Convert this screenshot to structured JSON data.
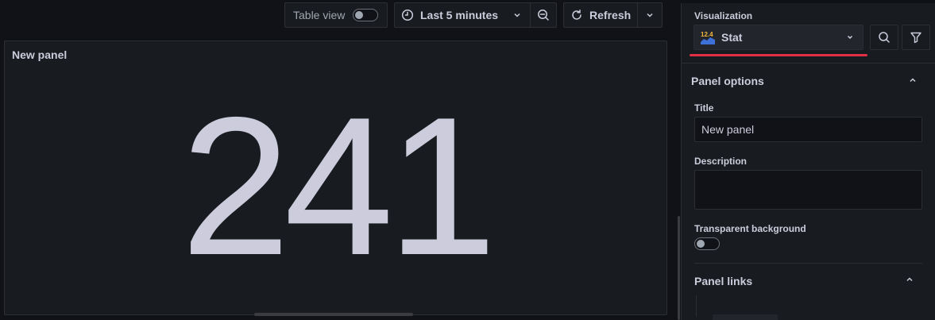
{
  "toolbar": {
    "table_view_label": "Table view",
    "table_view_on": false,
    "time_range_label": "Last 5 minutes",
    "refresh_label": "Refresh"
  },
  "panel": {
    "title": "New panel",
    "stat_value": "241"
  },
  "sidebar": {
    "visualization_label": "Visualization",
    "visualization_selected": "Stat",
    "visualization_icon_text": "12.4",
    "panel_options": {
      "heading": "Panel options",
      "title_label": "Title",
      "title_value": "New panel",
      "description_label": "Description",
      "description_value": "",
      "transparent_label": "Transparent background",
      "transparent_on": false
    },
    "panel_links_heading": "Panel links"
  },
  "colors": {
    "background": "#111217",
    "panel": "#181b1f",
    "text": "#ccccdc",
    "highlight_underline": "#e02f44",
    "stat_icon_orange": "#f5b73d",
    "stat_icon_blue": "#3d71d9"
  }
}
